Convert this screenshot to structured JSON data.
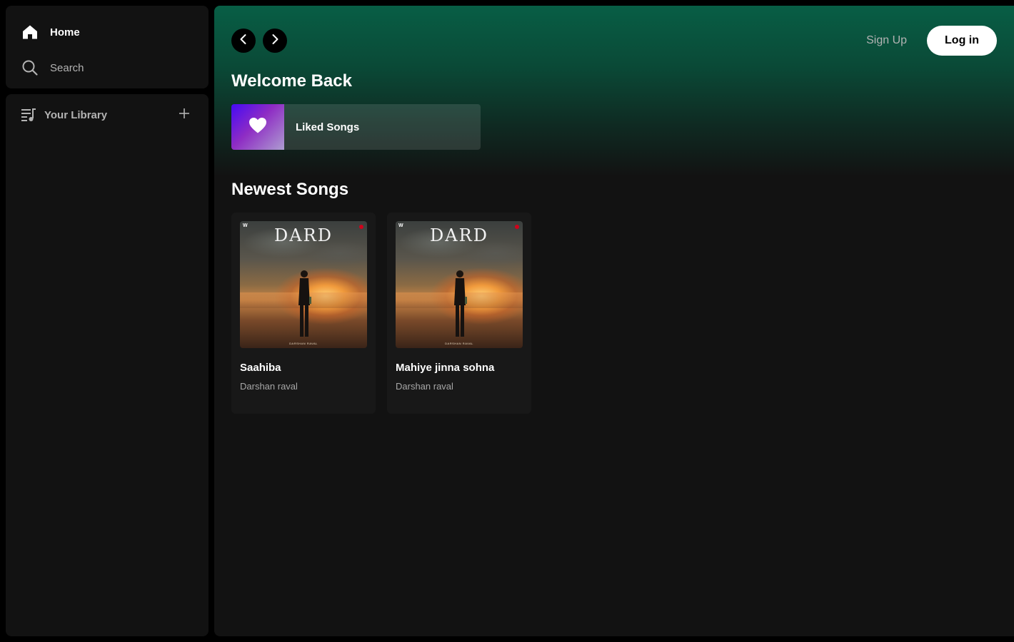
{
  "sidebar": {
    "nav": [
      {
        "label": "Home",
        "icon": "home-icon"
      },
      {
        "label": "Search",
        "icon": "search-icon"
      }
    ],
    "library": {
      "label": "Your Library",
      "icon": "library-icon",
      "add_icon": "plus-icon"
    }
  },
  "header": {
    "back_icon": "chevron-left-icon",
    "forward_icon": "chevron-right-icon",
    "signup_label": "Sign Up",
    "login_label": "Log in"
  },
  "main": {
    "welcome_title": "Welcome Back",
    "liked_songs": {
      "label": "Liked Songs",
      "icon": "heart-icon"
    },
    "newest_title": "Newest Songs",
    "songs": [
      {
        "title": "Saahiba",
        "artist": "Darshan raval",
        "cover_text": "DARD"
      },
      {
        "title": "Mahiye jinna sohna",
        "artist": "Darshan raval",
        "cover_text": "DARD"
      }
    ]
  },
  "colors": {
    "accent_gradient_top": "#085e45",
    "background": "#121212",
    "card": "#181818",
    "muted_text": "#b3b3b3"
  }
}
